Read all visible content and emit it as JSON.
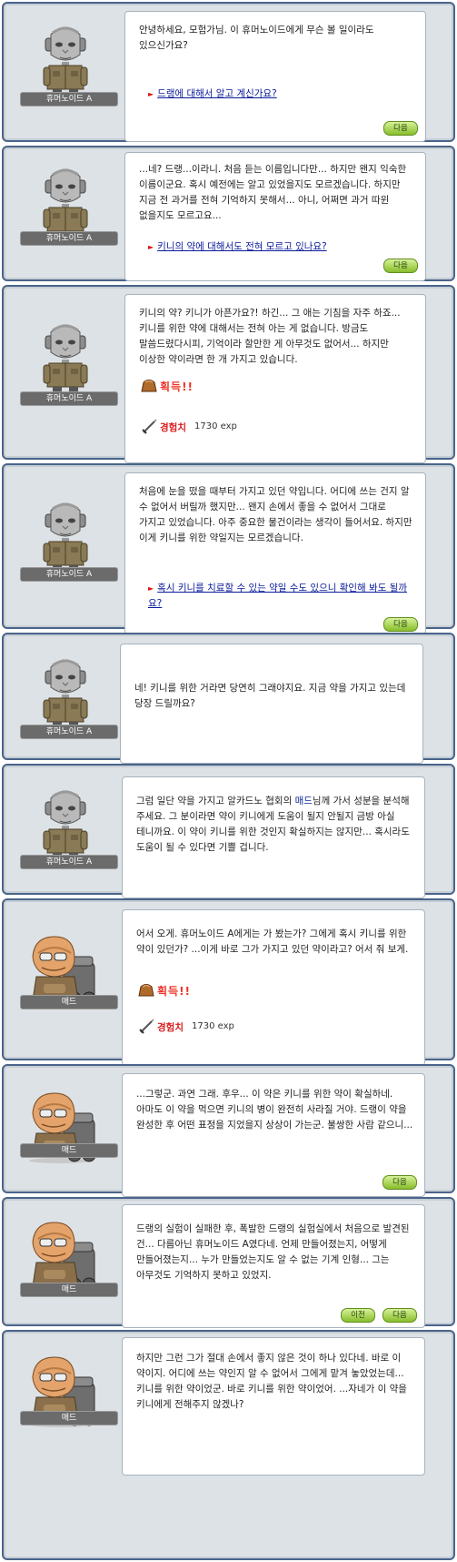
{
  "panels": [
    {
      "speaker": "휴머노이드 A",
      "portrait": "humanoid",
      "text": "안녕하세요, 모험가님. 이 휴머노이드에게 무슨 볼 일이라도 있으신가요?",
      "option": "드랭에 대해서 알고 계신가요?",
      "buttons": [
        "다음"
      ]
    },
    {
      "speaker": "휴머노이드 A",
      "portrait": "humanoid",
      "text": "...네? 드랭...이라니. 처음 듣는 이름입니다만... 하지만 왠지 익숙한 이름이군요. 혹시 예전에는 알고 있었을지도 모르겠습니다. 하지만 지금 전 과거를 전혀 기억하지 못해서... 아니, 어쩌면 과거 따윈 없을지도 모르고요...",
      "option": "키니의 약에 대해서도 전혀 모르고 있나요?",
      "buttons": [
        "다음"
      ]
    },
    {
      "speaker": "휴머노이드 A",
      "portrait": "humanoid",
      "text": "키니의 약? 키니가 아픈가요?! 하긴... 그 애는 기침을 자주 하죠... 키니를 위한 약에 대해서는 전혀 아는 게 없습니다. 방금도 말씀드렸다시피, 기억이라 할만한 게 아무것도 없어서... 하지만 이상한 약이라면 한 개 가지고 있습니다.",
      "reward": "획득!!",
      "exp_label": "경험치",
      "exp_value": "1730 exp"
    },
    {
      "speaker": "휴머노이드 A",
      "portrait": "humanoid",
      "text": "처음에 눈을 떴을 때부터 가지고 있던 약입니다. 어디에 쓰는 건지 알 수 없어서 버릴까 했지만... 왠지 손에서 좋을 수 없어서 그대로 가지고 있었습니다. 아주 중요한 물건이라는 생각이 들어서요. 하지만 이게 키니를 위한 약일지는 모르겠습니다.",
      "option": "혹시 키니를 치료할 수 있는 약일 수도 있으니 확인해 봐도 될까요?",
      "buttons": [
        "다음"
      ]
    },
    {
      "speaker": "휴머노이드 A",
      "portrait": "humanoid",
      "text": "네! 키니를 위한 거라면 당연히 그래야지요. 지금 약을 가지고 있는데 당장 드릴까요?"
    },
    {
      "speaker": "휴머노이드 A",
      "portrait": "humanoid",
      "text": "그럼 일단 약을 가지고 알카드노 협회의 매드님께 가서 성분을 분석해 주세요. 그 분이라면 약이 키니에게 도움이 될지 안될지 금방 아실 테니까요. 이 약이 키니를 위한 것인지 확실하지는 않지만... 혹시라도 도움이 될 수 있다면 기쁠 겁니다.",
      "highlight": "매드"
    },
    {
      "speaker": "매드",
      "portrait": "mad",
      "text": "어서 오게. 휴머노이드 A에게는 가 봤는가? 그에게 혹시 키니를 위한 약이 있던가? ...이게 바로 그가 가지고 있던 약이라고? 어서 줘 보게.",
      "reward": "획득!!",
      "exp_label": "경험치",
      "exp_value": "1730 exp"
    },
    {
      "speaker": "매드",
      "portrait": "mad",
      "text": "...그렇군. 과연 그래. 후우... 이 약은 키니를 위한 약이 확실하네. 아마도 이 약을 먹으면 키니의 병이 완전히 사라질 거야. 드랭이 약을 완성한 후 어떤 표정을 지었을지 상상이 가는군. 불쌍한 사람 같으니...",
      "buttons": [
        "다음"
      ]
    },
    {
      "speaker": "매드",
      "portrait": "mad",
      "text": "드랭의 실험이 실패한 후, 폭발한 드랭의 실험실에서 처음으로 발견된 건... 다름아닌 휴머노이드 A였다네. 언제 만들어졌는지, 어떻게 만들어졌는지... 누가 만들었는지도 알 수 없는 기계 인형... 그는 아무것도 기억하지 못하고 있었지.",
      "buttons": [
        "이전",
        "다음"
      ]
    },
    {
      "speaker": "매드",
      "portrait": "mad",
      "text": "하지만 그런 그가 절대 손에서 좋지 않은 것이 하나 있다네. 바로 이 약이지. 어디에 쓰는 약인지 알 수 없어서 그에게 맡겨 놓았었는데... 키니를 위한 약이었군. 바로 키니를 위한 약이었어. ...자네가 이 약을 키니에게 전해주지 않겠나?"
    }
  ]
}
